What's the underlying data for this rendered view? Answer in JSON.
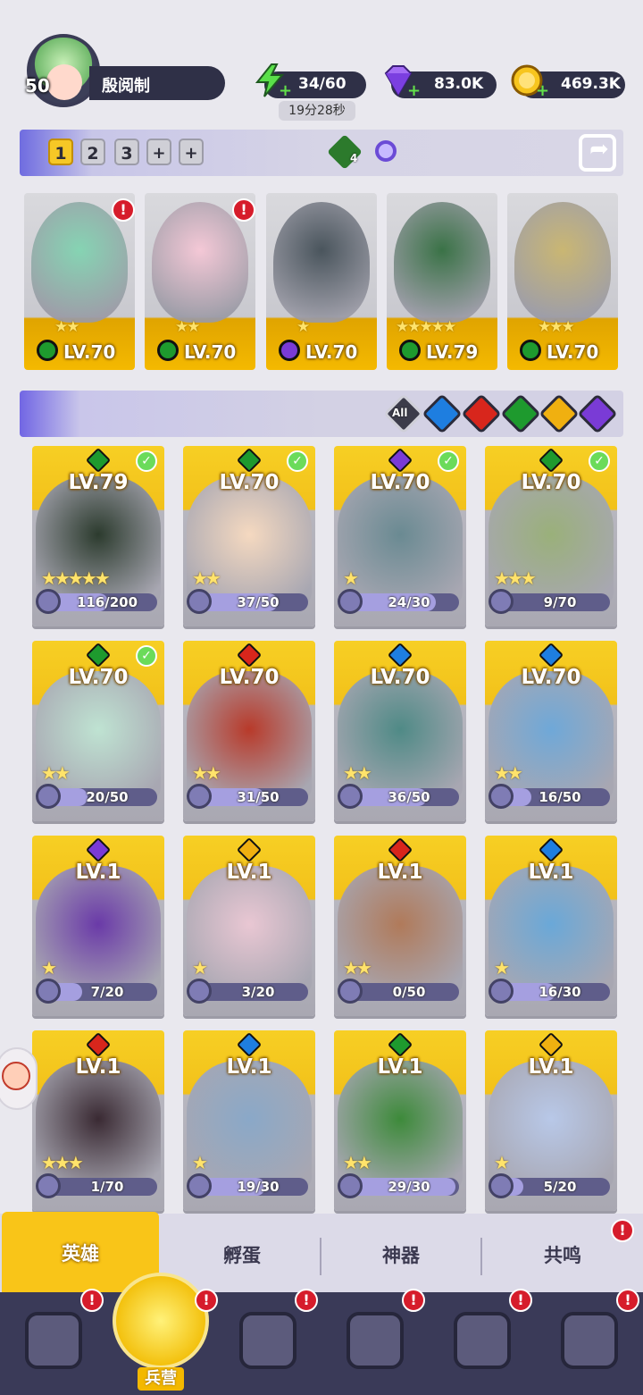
{
  "player": {
    "level": "50",
    "name": "殷阅制"
  },
  "resources": {
    "energy": "34/60",
    "energy_timer": "19分28秒",
    "gems": "83.0K",
    "gold": "469.3K"
  },
  "team": {
    "slots": [
      "1",
      "2",
      "3",
      "+",
      "+"
    ],
    "active_slot": "1",
    "gem_badge_count": "4",
    "members": [
      {
        "level": "LV.70",
        "element": "nature",
        "stars": "★★",
        "alert": true
      },
      {
        "level": "LV.70",
        "element": "nature",
        "stars": "★★",
        "alert": true
      },
      {
        "level": "LV.70",
        "element": "dark",
        "stars": "★",
        "alert": false
      },
      {
        "level": "LV.79",
        "element": "nature",
        "stars": "★★★★★",
        "alert": false
      },
      {
        "level": "LV.70",
        "element": "nature",
        "stars": "★★★",
        "alert": false
      }
    ]
  },
  "filters": {
    "all_label": "All",
    "elements": [
      "water",
      "fire",
      "nature",
      "light",
      "dark"
    ]
  },
  "colors": {
    "nature": "#1e9a2e",
    "dark": "#7a3bd6",
    "water": "#1e7ee0",
    "fire": "#d8261c",
    "light": "#f0b010"
  },
  "heroes": [
    {
      "level": "LV.79",
      "element": "nature",
      "shards": "116/200",
      "progress": 0.58,
      "stars": "★★★★★",
      "equipped": true
    },
    {
      "level": "LV.70",
      "element": "nature",
      "shards": "37/50",
      "progress": 0.74,
      "stars": "★★",
      "equipped": true
    },
    {
      "level": "LV.70",
      "element": "dark",
      "shards": "24/30",
      "progress": 0.8,
      "stars": "★",
      "equipped": true
    },
    {
      "level": "LV.70",
      "element": "nature",
      "shards": "9/70",
      "progress": 0.13,
      "stars": "★★★",
      "equipped": true
    },
    {
      "level": "LV.70",
      "element": "nature",
      "shards": "20/50",
      "progress": 0.4,
      "stars": "★★",
      "equipped": true
    },
    {
      "level": "LV.70",
      "element": "fire",
      "shards": "31/50",
      "progress": 0.62,
      "stars": "★★",
      "equipped": false
    },
    {
      "level": "LV.70",
      "element": "water",
      "shards": "36/50",
      "progress": 0.72,
      "stars": "★★",
      "equipped": false
    },
    {
      "level": "LV.70",
      "element": "water",
      "shards": "16/50",
      "progress": 0.32,
      "stars": "★★",
      "equipped": false
    },
    {
      "level": "LV.1",
      "element": "dark",
      "shards": "7/20",
      "progress": 0.35,
      "stars": "★",
      "equipped": false
    },
    {
      "level": "LV.1",
      "element": "light",
      "shards": "3/20",
      "progress": 0.15,
      "stars": "★",
      "equipped": false
    },
    {
      "level": "LV.1",
      "element": "fire",
      "shards": "0/50",
      "progress": 0.0,
      "stars": "★★",
      "equipped": false
    },
    {
      "level": "LV.1",
      "element": "water",
      "shards": "16/30",
      "progress": 0.53,
      "stars": "★",
      "equipped": false
    },
    {
      "level": "LV.1",
      "element": "fire",
      "shards": "1/70",
      "progress": 0.01,
      "stars": "★★★",
      "equipped": false
    },
    {
      "level": "LV.1",
      "element": "water",
      "shards": "19/30",
      "progress": 0.63,
      "stars": "★",
      "equipped": false
    },
    {
      "level": "LV.1",
      "element": "nature",
      "shards": "29/30",
      "progress": 0.97,
      "stars": "★★",
      "equipped": false
    },
    {
      "level": "LV.1",
      "element": "light",
      "shards": "5/20",
      "progress": 0.25,
      "stars": "★",
      "equipped": false
    }
  ],
  "subtabs": [
    "英雄",
    "孵蛋",
    "神器",
    "共鸣"
  ],
  "active_subtab": "英雄",
  "bottom_nav": {
    "active_label": "兵营",
    "items": [
      "cards",
      "barracks",
      "map",
      "castle",
      "mushroom",
      "banner"
    ]
  },
  "alert_mark": "!"
}
